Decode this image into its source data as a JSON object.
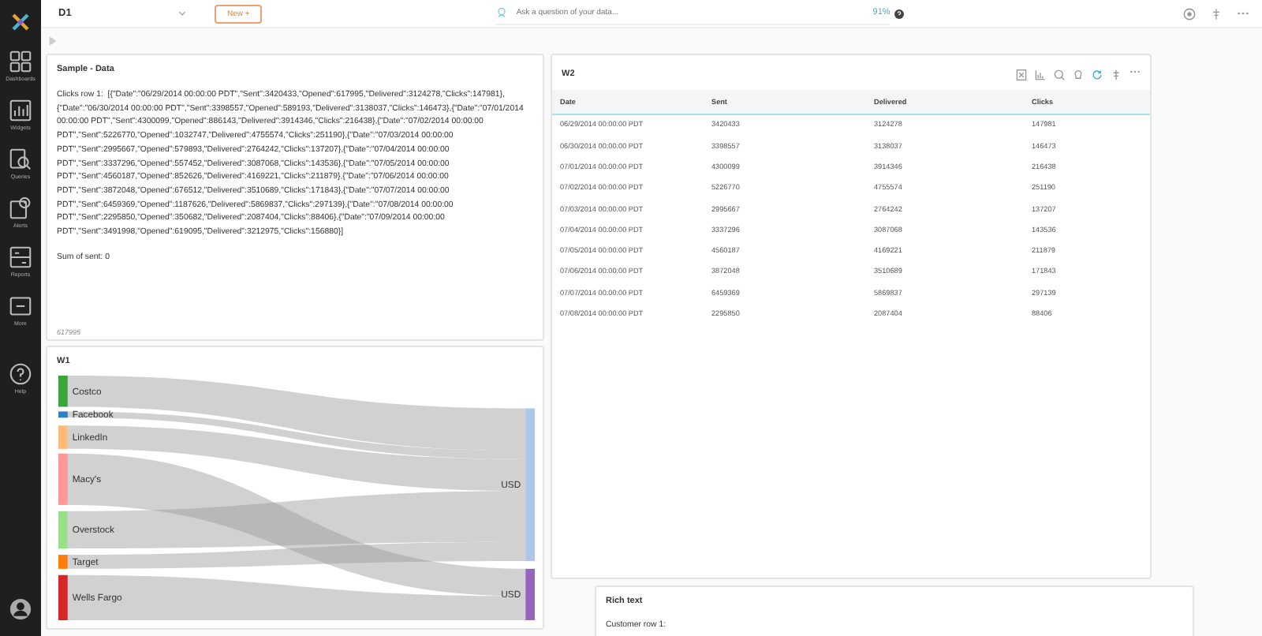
{
  "sidebar": {
    "items": [
      {
        "label": "Dashboards",
        "kind": "dashboards"
      },
      {
        "label": "Widgets",
        "kind": "widgets"
      },
      {
        "label": "Queries",
        "kind": "queries"
      },
      {
        "label": "Alerts",
        "kind": "alerts"
      },
      {
        "label": "Reports",
        "kind": "reports"
      },
      {
        "label": "More",
        "kind": "more"
      },
      {
        "label": "Help",
        "kind": "help"
      }
    ]
  },
  "topbar": {
    "dashboard": "D1",
    "new_button": "New +",
    "search": {
      "placeholder": "Ask a question of your data..."
    },
    "confidence": "91%"
  },
  "sample_widget": {
    "title": "Sample - Data",
    "label": "Clicks row 1:",
    "value": "[{\"Date\":\"06/29/2014 00:00:00 PDT\",\"Sent\":3420433,\"Opened\":617995,\"Delivered\":3124278,\"Clicks\":147981},{\"Date\":\"06/30/2014 00:00:00 PDT\",\"Sent\":3398557,\"Opened\":589193,\"Delivered\":3138037,\"Clicks\":146473},{\"Date\":\"07/01/2014 00:00:00 PDT\",\"Sent\":4300099,\"Opened\":886143,\"Delivered\":3914346,\"Clicks\":216438},{\"Date\":\"07/02/2014 00:00:00 PDT\",\"Sent\":5226770,\"Opened\":1032747,\"Delivered\":4755574,\"Clicks\":251190},{\"Date\":\"07/03/2014 00:00:00 PDT\",\"Sent\":2995667,\"Opened\":579893,\"Delivered\":2764242,\"Clicks\":137207},{\"Date\":\"07/04/2014 00:00:00 PDT\",\"Sent\":3337296,\"Opened\":557452,\"Delivered\":3087068,\"Clicks\":143536},{\"Date\":\"07/05/2014 00:00:00 PDT\",\"Sent\":4560187,\"Opened\":852626,\"Delivered\":4169221,\"Clicks\":211879},{\"Date\":\"07/06/2014 00:00:00 PDT\",\"Sent\":3872048,\"Opened\":676512,\"Delivered\":3510689,\"Clicks\":171843},{\"Date\":\"07/07/2014 00:00:00 PDT\",\"Sent\":6459369,\"Opened\":1187626,\"Delivered\":5869837,\"Clicks\":297139},{\"Date\":\"07/08/2014 00:00:00 PDT\",\"Sent\":2295850,\"Opened\":350682,\"Delivered\":2087404,\"Clicks\":88406},{\"Date\":\"07/09/2014 00:00:00 PDT\",\"Sent\":3491998,\"Opened\":619095,\"Delivered\":3212975,\"Clicks\":156880}]",
    "sum": "Sum of sent: 0",
    "footer": "617995"
  },
  "sankey_widget": {
    "title": "W1",
    "sources": [
      {
        "label": "Costco",
        "color": "#3aa53a"
      },
      {
        "label": "Facebook",
        "color": "#2f7fc1"
      },
      {
        "label": "LinkedIn",
        "color": "#ffbb78"
      },
      {
        "label": "Macy's",
        "color": "#ff9896"
      },
      {
        "label": "Overstock",
        "color": "#98df8a"
      },
      {
        "label": "Target",
        "color": "#ff7f0e"
      },
      {
        "label": "Wells Fargo",
        "color": "#d62728"
      }
    ],
    "targets": [
      {
        "label": "USD",
        "color": "#aec7e8"
      },
      {
        "label": "USD",
        "color": "#9467bd"
      }
    ]
  },
  "table_widget": {
    "title": "W2",
    "columns": [
      "Date",
      "Sent",
      "Delivered",
      "Clicks"
    ],
    "rows": [
      [
        "06/29/2014 00:00:00 PDT",
        "3420433",
        "3124278",
        "147981"
      ],
      [
        "06/30/2014 00:00:00 PDT",
        "3398557",
        "3138037",
        "146473"
      ],
      [
        "07/01/2014 00:00:00 PDT",
        "4300099",
        "3914346",
        "216438"
      ],
      [
        "07/02/2014 00:00:00 PDT",
        "5226770",
        "4755574",
        "251190"
      ],
      [
        "07/03/2014 00:00:00 PDT",
        "2995667",
        "2764242",
        "137207"
      ],
      [
        "07/04/2014 00:00:00 PDT",
        "3337296",
        "3087068",
        "143536"
      ],
      [
        "07/05/2014 00:00:00 PDT",
        "4560187",
        "4169221",
        "211879"
      ],
      [
        "07/06/2014 00:00:00 PDT",
        "3872048",
        "3510689",
        "171843"
      ],
      [
        "07/07/2014 00:00:00 PDT",
        "6459369",
        "5869837",
        "297139"
      ],
      [
        "07/08/2014 00:00:00 PDT",
        "2295850",
        "2087404",
        "88406"
      ]
    ]
  },
  "rich_text_widget": {
    "title": "Rich text",
    "body": "Customer row 1:"
  }
}
